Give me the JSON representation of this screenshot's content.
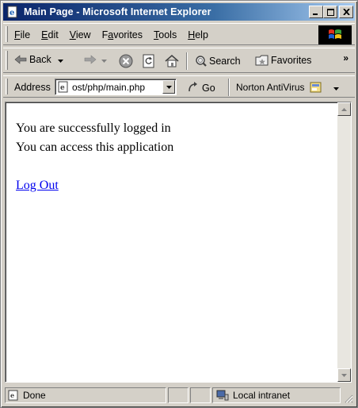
{
  "window": {
    "title": "Main Page - Microsoft Internet Explorer",
    "minimize_glyph": "_",
    "maximize_glyph": "□",
    "close_glyph": "✕"
  },
  "menu": {
    "items": [
      {
        "label": "File",
        "accel": "F",
        "rest": "ile"
      },
      {
        "label": "Edit",
        "accel": "E",
        "rest": "dit"
      },
      {
        "label": "View",
        "accel": "V",
        "rest": "iew"
      },
      {
        "label": "Favorites",
        "accel": "a",
        "pre": "F",
        "rest": "vorites"
      },
      {
        "label": "Tools",
        "accel": "T",
        "rest": "ools"
      },
      {
        "label": "Help",
        "accel": "H",
        "rest": "elp"
      }
    ]
  },
  "toolbar": {
    "back_label": "Back",
    "search_label": "Search",
    "favorites_label": "Favorites",
    "more_glyph": "»"
  },
  "address": {
    "label": "Address",
    "value": "ost/php/main.php",
    "go_label": "Go",
    "norton_label": "Norton AntiVirus"
  },
  "page": {
    "line1": "You are successfully logged in",
    "line2": "You can access this application",
    "logout_link": "Log Out"
  },
  "status": {
    "text": "Done",
    "zone": "Local intranet"
  },
  "colors": {
    "title_start": "#0a246a",
    "title_end": "#a6caf0",
    "chrome": "#d4d0c8",
    "link": "#0000ee"
  }
}
